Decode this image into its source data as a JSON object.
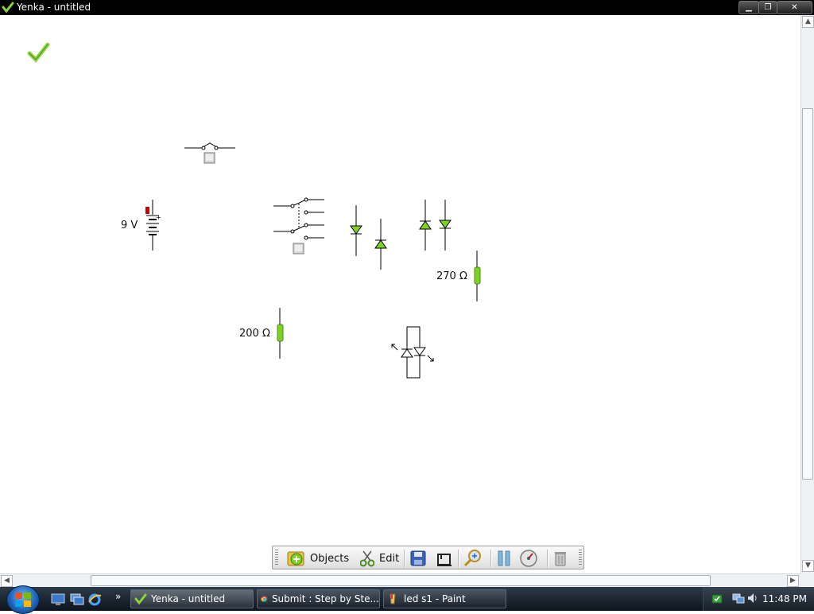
{
  "window": {
    "title": "Yenka - untitled"
  },
  "canvas": {
    "labels": {
      "battery": "9 V",
      "resistor_top": "270 Ω",
      "resistor_bottom": "200 Ω"
    }
  },
  "components": {
    "push_switch": "push-switch",
    "battery": "battery",
    "dpdt_switch": "double-pole-switch",
    "led_a": "led",
    "led_b": "led",
    "led_c": "led",
    "led_d": "led",
    "resistor_270": "resistor",
    "resistor_200": "resistor",
    "bicolor_led": "bi-colour-led"
  },
  "toolbar": {
    "objects_label": "Objects",
    "edit_label": "Edit",
    "icons": [
      "objects-icon",
      "scissors-icon",
      "save-icon",
      "save-as-icon",
      "zoom-icon",
      "pause-icon",
      "speed-gauge-icon",
      "trash-icon"
    ]
  },
  "taskbar": {
    "items": [
      {
        "label": "Yenka - untitled"
      },
      {
        "label": "Submit : Step by Ste..."
      },
      {
        "label": "led s1 - Paint"
      }
    ],
    "time": "11:48 PM",
    "more_label": "»"
  },
  "colors": {
    "component_green": "#7ed321",
    "battery_red": "#cc0000",
    "titlebar_bg": "#000000",
    "taskbar_bg": "#1a2430"
  }
}
